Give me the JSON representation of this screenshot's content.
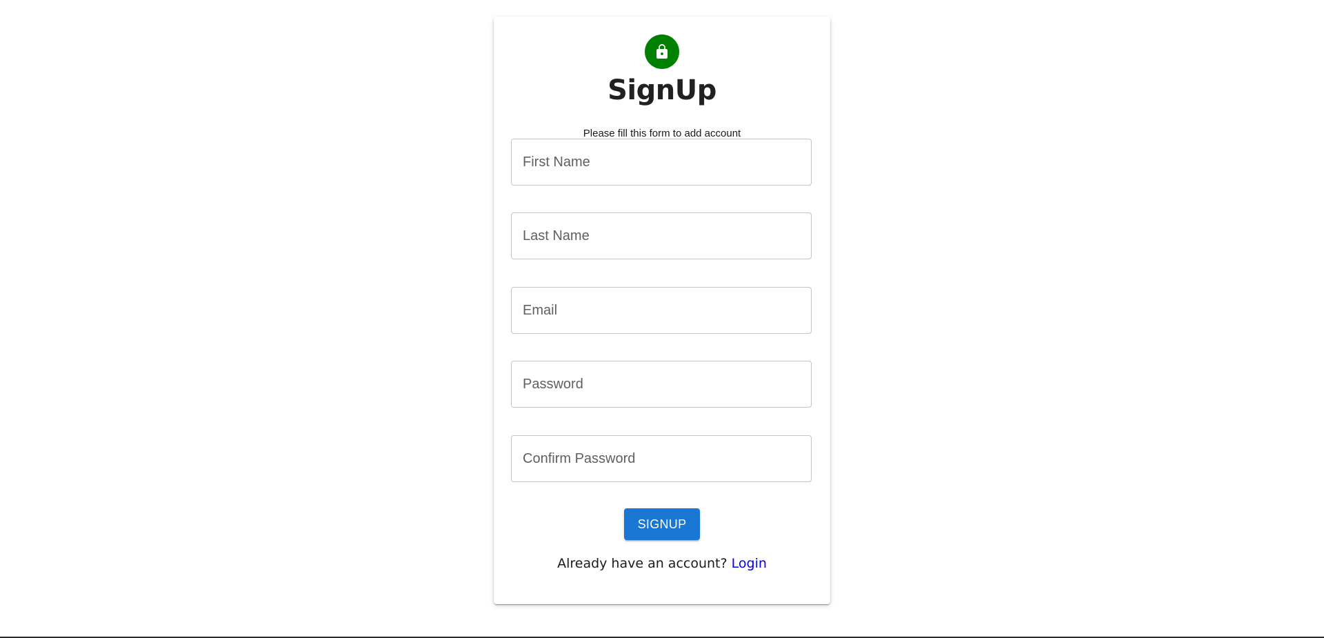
{
  "header": {
    "icon": "lock-icon",
    "title": "SignUp",
    "subtitle": "Please fill this form to add account"
  },
  "form": {
    "first_name_placeholder": "First Name",
    "last_name_placeholder": "Last Name",
    "email_placeholder": "Email",
    "password_placeholder": "Password",
    "confirm_password_placeholder": "Confirm Password",
    "first_name_value": "",
    "last_name_value": "",
    "email_value": "",
    "password_value": "",
    "confirm_password_value": "",
    "submit_label": "SIGNUP"
  },
  "footer": {
    "prompt": "Already have an account?",
    "login_link": "Login"
  },
  "colors": {
    "avatar_bg": "#008000",
    "button_bg": "#1976d2",
    "link": "#0000ee"
  }
}
